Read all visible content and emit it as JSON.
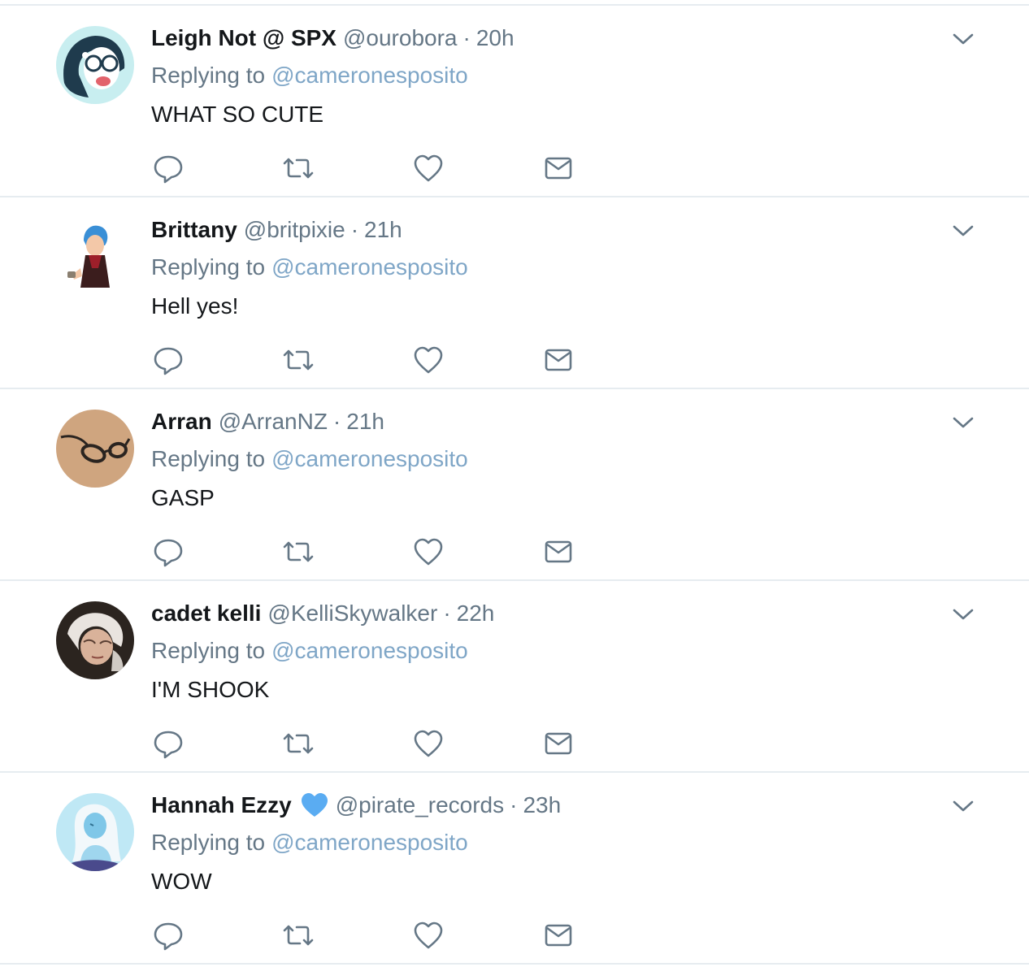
{
  "replying_label": "Replying to",
  "colors": {
    "text_primary": "#14171a",
    "text_secondary": "#657786",
    "mention": "#7fa6c7",
    "divider": "#e6ecf0",
    "icon": "#657786",
    "verified_heart": "#5aacf2"
  },
  "icons": {
    "reply": "reply-icon",
    "retweet": "retweet-icon",
    "like": "like-icon",
    "direct_message": "direct-message-icon",
    "more": "chevron-down-icon"
  },
  "tweets": [
    {
      "name": "Leigh Not @ SPX",
      "handle": "@ourobora",
      "separator": "·",
      "time": "20h",
      "reply_to": "@cameronesposito",
      "text": "WHAT SO CUTE"
    },
    {
      "name": "Brittany",
      "handle": "@britpixie",
      "separator": "·",
      "time": "21h",
      "reply_to": "@cameronesposito",
      "text": "Hell yes!"
    },
    {
      "name": "Arran",
      "handle": "@ArranNZ",
      "separator": "·",
      "time": "21h",
      "reply_to": "@cameronesposito",
      "text": "GASP"
    },
    {
      "name": "cadet kelli",
      "handle": "@KelliSkywalker",
      "separator": "·",
      "time": "22h",
      "reply_to": "@cameronesposito",
      "text": "I'M SHOOK"
    },
    {
      "name": "Hannah Ezzy",
      "handle": "@pirate_records",
      "separator": "·",
      "time": "23h",
      "reply_to": "@cameronesposito",
      "text": "WOW"
    }
  ]
}
